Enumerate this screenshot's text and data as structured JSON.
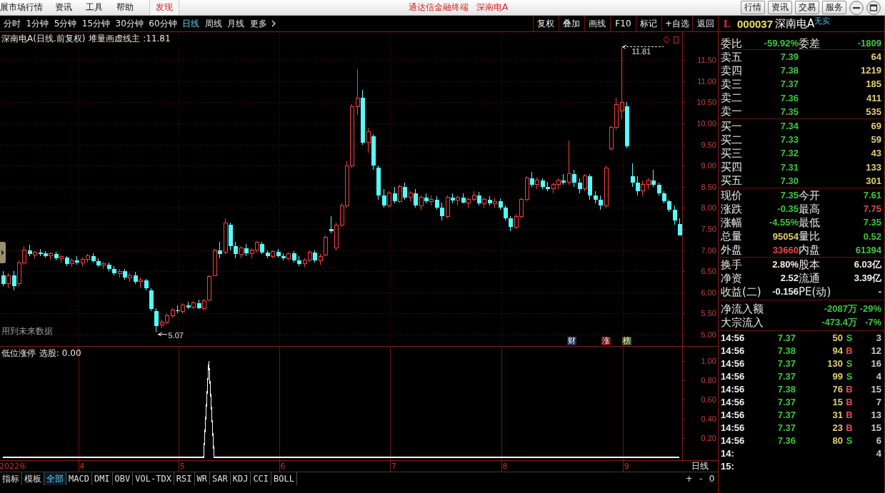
{
  "title_bar": {
    "menus": [
      "展市场行情",
      "资讯",
      "工具",
      "帮助"
    ],
    "discover": "发现",
    "app_name": "通达信金融终端",
    "security": "深南电A",
    "buttons": [
      "行情",
      "资讯",
      "交易",
      "服务"
    ]
  },
  "period_tabs": [
    {
      "label": "分时",
      "selected": false
    },
    {
      "label": "1分钟",
      "selected": false
    },
    {
      "label": "5分钟",
      "selected": false
    },
    {
      "label": "15分钟",
      "selected": false
    },
    {
      "label": "30分钟",
      "selected": false
    },
    {
      "label": "60分钟",
      "selected": false
    },
    {
      "label": "日线",
      "selected": true
    },
    {
      "label": "周线",
      "selected": false
    },
    {
      "label": "月线",
      "selected": false
    }
  ],
  "more": "更多",
  "chart_tools": [
    "复权",
    "叠加",
    "画线",
    "F10",
    "标记",
    "+自选",
    "返回"
  ],
  "quote_header": {
    "market": "L",
    "code": "000037",
    "name": "深南电A",
    "tag": "无实"
  },
  "chart": {
    "title": "深南电A(日线.前复权)",
    "indicator": "堆量画虚线主 :11.81",
    "note": "用到未来数据",
    "events": [
      {
        "label": "财",
        "kind": "finance"
      },
      {
        "label": "涨",
        "kind": "limit"
      },
      {
        "label": "榜",
        "kind": "ranking"
      }
    ],
    "indicator_name": "低位涨停",
    "indicator_value": "选股: 0.00",
    "chart_data": [
      {
        "type": "candlestick",
        "ylim": [
          4.73,
          12.16
        ],
        "yticks": [
          {
            "value": 5,
            "label": "5.00"
          },
          {
            "value": 5.5,
            "label": "5.50"
          },
          {
            "value": 6,
            "label": "6.00"
          },
          {
            "value": 6.5,
            "label": "6.50"
          },
          {
            "value": 7,
            "label": "7.00"
          },
          {
            "value": 7.5,
            "label": "7.50"
          },
          {
            "value": 8,
            "label": "8.00"
          },
          {
            "value": 8.5,
            "label": "8.50"
          },
          {
            "value": 9,
            "label": "9.00"
          },
          {
            "value": 9.5,
            "label": "9.50"
          },
          {
            "value": 10,
            "label": "10.00"
          },
          {
            "value": 10.5,
            "label": "10.50"
          },
          {
            "value": 11,
            "label": "11.00"
          },
          {
            "value": 11.5,
            "label": "11.50"
          }
        ],
        "grid": true,
        "annotations": [
          "11.81",
          "5.07"
        ],
        "ohlc": [
          [
            6.4,
            6.5,
            6.15,
            6.2
          ],
          [
            6.2,
            6.45,
            6.1,
            6.4
          ],
          [
            6.4,
            6.5,
            6.05,
            6.15
          ],
          [
            6.2,
            6.75,
            6.15,
            6.7
          ],
          [
            6.7,
            7.1,
            6.65,
            7.0
          ],
          [
            7.0,
            7.12,
            6.85,
            6.9
          ],
          [
            6.88,
            6.98,
            6.8,
            6.95
          ],
          [
            6.95,
            7.02,
            6.85,
            6.9
          ],
          [
            6.92,
            6.98,
            6.82,
            6.86
          ],
          [
            6.86,
            6.95,
            6.78,
            6.92
          ],
          [
            6.9,
            6.96,
            6.75,
            6.8
          ],
          [
            6.8,
            6.88,
            6.7,
            6.85
          ],
          [
            6.82,
            6.86,
            6.62,
            6.68
          ],
          [
            6.68,
            6.8,
            6.6,
            6.75
          ],
          [
            6.75,
            6.85,
            6.65,
            6.7
          ],
          [
            6.7,
            6.82,
            6.62,
            6.78
          ],
          [
            6.78,
            6.9,
            6.72,
            6.86
          ],
          [
            6.86,
            6.92,
            6.7,
            6.74
          ],
          [
            6.74,
            6.8,
            6.6,
            6.64
          ],
          [
            6.64,
            6.72,
            6.55,
            6.68
          ],
          [
            6.66,
            6.7,
            6.5,
            6.55
          ],
          [
            6.55,
            6.62,
            6.4,
            6.45
          ],
          [
            6.45,
            6.55,
            6.35,
            6.5
          ],
          [
            6.5,
            6.55,
            6.3,
            6.35
          ],
          [
            6.35,
            6.45,
            6.25,
            6.4
          ],
          [
            6.4,
            6.48,
            6.2,
            6.25
          ],
          [
            6.25,
            6.35,
            6.1,
            6.3
          ],
          [
            6.28,
            6.32,
            6.05,
            6.1
          ],
          [
            6.05,
            6.1,
            5.55,
            5.6
          ],
          [
            5.55,
            5.62,
            5.07,
            5.2
          ],
          [
            5.22,
            5.35,
            5.15,
            5.3
          ],
          [
            5.3,
            5.5,
            5.25,
            5.45
          ],
          [
            5.45,
            5.62,
            5.4,
            5.58
          ],
          [
            5.58,
            5.7,
            5.5,
            5.55
          ],
          [
            5.55,
            5.75,
            5.5,
            5.7
          ],
          [
            5.7,
            5.78,
            5.6,
            5.65
          ],
          [
            5.65,
            5.8,
            5.6,
            5.75
          ],
          [
            5.75,
            5.82,
            5.6,
            5.62
          ],
          [
            5.62,
            5.85,
            5.58,
            5.8
          ],
          [
            5.82,
            6.4,
            5.8,
            6.38
          ],
          [
            6.4,
            7.02,
            6.38,
            7.0
          ],
          [
            7.0,
            7.2,
            6.8,
            6.9
          ],
          [
            6.95,
            7.75,
            6.9,
            7.65
          ],
          [
            7.6,
            7.65,
            7.0,
            7.1
          ],
          [
            7.1,
            7.2,
            6.8,
            6.9
          ],
          [
            6.9,
            7.1,
            6.8,
            7.05
          ],
          [
            7.05,
            7.15,
            6.85,
            6.92
          ],
          [
            6.92,
            7.05,
            6.8,
            7.0
          ],
          [
            7.0,
            7.22,
            6.95,
            7.18
          ],
          [
            7.15,
            7.2,
            6.9,
            6.95
          ],
          [
            6.95,
            7.0,
            6.8,
            6.85
          ],
          [
            6.85,
            7.0,
            6.8,
            6.96
          ],
          [
            6.96,
            7.02,
            6.82,
            6.86
          ],
          [
            6.86,
            6.92,
            6.75,
            6.8
          ],
          [
            6.8,
            6.95,
            6.75,
            6.92
          ],
          [
            6.92,
            6.98,
            6.7,
            6.75
          ],
          [
            6.75,
            6.85,
            6.62,
            6.68
          ],
          [
            6.68,
            6.8,
            6.6,
            6.76
          ],
          [
            6.76,
            7.0,
            6.72,
            6.95
          ],
          [
            6.95,
            7.0,
            6.7,
            6.75
          ],
          [
            6.75,
            6.9,
            6.65,
            6.85
          ],
          [
            6.88,
            7.35,
            6.85,
            7.3
          ],
          [
            7.5,
            7.8,
            7.4,
            7.45
          ],
          [
            7.05,
            7.65,
            7.0,
            7.6
          ],
          [
            7.6,
            8.1,
            7.55,
            8.05
          ],
          [
            8.05,
            9.1,
            8.0,
            9.0
          ],
          [
            9.0,
            10.45,
            8.95,
            10.4
          ],
          [
            10.4,
            11.28,
            10.2,
            10.6
          ],
          [
            10.6,
            10.8,
            9.5,
            9.55
          ],
          [
            9.55,
            9.9,
            9.3,
            9.8
          ],
          [
            9.7,
            9.75,
            8.9,
            9.0
          ],
          [
            8.95,
            9.0,
            8.2,
            8.3
          ],
          [
            8.3,
            8.45,
            8.0,
            8.05
          ],
          [
            8.05,
            8.4,
            8.0,
            8.35
          ],
          [
            8.35,
            8.5,
            8.1,
            8.15
          ],
          [
            8.15,
            8.55,
            8.1,
            8.5
          ],
          [
            8.5,
            8.6,
            8.2,
            8.25
          ],
          [
            8.25,
            8.4,
            8.15,
            8.35
          ],
          [
            8.35,
            8.45,
            8.0,
            8.05
          ],
          [
            8.05,
            8.3,
            7.95,
            8.25
          ],
          [
            8.25,
            8.35,
            8.1,
            8.15
          ],
          [
            8.15,
            8.3,
            8.05,
            8.2
          ],
          [
            8.2,
            8.28,
            7.95,
            8.0
          ],
          [
            8.0,
            8.12,
            7.7,
            7.8
          ],
          [
            7.8,
            8.3,
            7.75,
            8.25
          ],
          [
            8.25,
            8.35,
            8.1,
            8.18
          ],
          [
            8.18,
            8.3,
            8.05,
            8.25
          ],
          [
            8.25,
            8.35,
            8.1,
            8.12
          ],
          [
            8.12,
            8.25,
            8.0,
            8.2
          ],
          [
            8.2,
            8.4,
            8.15,
            8.3
          ],
          [
            8.3,
            8.38,
            8.05,
            8.1
          ],
          [
            8.1,
            8.25,
            8.0,
            8.2
          ],
          [
            8.2,
            8.28,
            8.05,
            8.1
          ],
          [
            8.1,
            8.25,
            8.0,
            8.15
          ],
          [
            8.15,
            8.22,
            7.95,
            8.0
          ],
          [
            8.0,
            8.05,
            7.7,
            7.75
          ],
          [
            7.75,
            7.8,
            7.45,
            7.55
          ],
          [
            7.55,
            7.85,
            7.5,
            7.8
          ],
          [
            7.8,
            8.25,
            7.75,
            8.2
          ],
          [
            8.2,
            8.75,
            8.15,
            8.7
          ],
          [
            8.7,
            8.85,
            8.5,
            8.55
          ],
          [
            8.55,
            8.72,
            8.45,
            8.65
          ],
          [
            8.65,
            8.7,
            8.45,
            8.5
          ],
          [
            8.5,
            8.62,
            8.4,
            8.45
          ],
          [
            8.45,
            8.6,
            8.35,
            8.55
          ],
          [
            8.55,
            8.7,
            8.45,
            8.65
          ],
          [
            8.65,
            8.8,
            8.55,
            8.6
          ],
          [
            8.6,
            9.6,
            8.55,
            8.8
          ],
          [
            8.8,
            8.9,
            8.5,
            8.6
          ],
          [
            8.6,
            8.7,
            8.35,
            8.45
          ],
          [
            8.45,
            8.8,
            8.4,
            8.75
          ],
          [
            8.75,
            8.8,
            8.2,
            8.3
          ],
          [
            8.3,
            8.4,
            8.1,
            8.2
          ],
          [
            8.2,
            8.3,
            7.95,
            8.05
          ],
          [
            8.05,
            9.0,
            8.0,
            8.95
          ],
          [
            9.4,
            9.95,
            9.35,
            9.9
          ],
          [
            9.9,
            10.6,
            9.85,
            10.45
          ],
          [
            10.3,
            11.81,
            10.1,
            10.5
          ],
          [
            10.4,
            10.5,
            9.4,
            9.45
          ],
          [
            8.75,
            9.05,
            8.5,
            8.6
          ],
          [
            8.6,
            8.75,
            8.3,
            8.4
          ],
          [
            8.4,
            8.65,
            8.3,
            8.55
          ],
          [
            8.55,
            8.7,
            8.45,
            8.65
          ],
          [
            8.65,
            8.9,
            8.5,
            8.55
          ],
          [
            8.55,
            8.6,
            8.3,
            8.35
          ],
          [
            8.35,
            8.4,
            8.1,
            8.15
          ],
          [
            8.15,
            8.2,
            7.9,
            7.95
          ],
          [
            7.95,
            8.05,
            7.6,
            7.7
          ],
          [
            7.61,
            7.75,
            7.35,
            7.35
          ]
        ]
      },
      {
        "type": "line",
        "color": "#ffffff",
        "grid": true,
        "ylim": [
          -0.03,
          1.15
        ],
        "yticks": [
          {
            "value": 0.2,
            "label": "0.20"
          },
          {
            "value": 0.4,
            "label": "0.40"
          },
          {
            "value": 0.6,
            "label": "0.60"
          },
          {
            "value": 0.8,
            "label": "0.80"
          },
          {
            "value": 1,
            "label": "1.00"
          }
        ],
        "categories": [
          null,
          null,
          "2022年",
          null,
          null,
          null,
          null,
          null,
          null,
          null,
          null,
          null,
          null,
          null,
          null,
          "4",
          null,
          null,
          null,
          null,
          null,
          null,
          null,
          null,
          null,
          null,
          null,
          null,
          null,
          null,
          null,
          null,
          null,
          null,
          "5",
          null,
          null,
          null,
          null,
          null,
          null,
          null,
          null,
          null,
          null,
          null,
          null,
          null,
          null,
          null,
          null,
          null,
          null,
          "6",
          null,
          null,
          null,
          null,
          null,
          null,
          null,
          null,
          null,
          null,
          null,
          null,
          null,
          null,
          null,
          null,
          null,
          null,
          null,
          null,
          "7",
          null,
          null,
          null,
          null,
          null,
          null,
          null,
          null,
          null,
          null,
          null,
          null,
          null,
          null,
          null,
          null,
          null,
          null,
          null,
          null,
          "8",
          null,
          null,
          null,
          null,
          null,
          null,
          null,
          null,
          null,
          null,
          null,
          null,
          null,
          null,
          null,
          null,
          null,
          null,
          null,
          null,
          null,
          null,
          "9",
          null,
          null,
          null,
          null,
          null,
          null,
          null,
          null,
          null,
          null
        ],
        "values": [
          0,
          0,
          0,
          0,
          0,
          0,
          0,
          0,
          0,
          0,
          0,
          0,
          0,
          0,
          0,
          0,
          0,
          0,
          0,
          0,
          0,
          0,
          0,
          0,
          0,
          0,
          0,
          0,
          0,
          0,
          0,
          0,
          0,
          0,
          0,
          0,
          0,
          0,
          0,
          1,
          0,
          0,
          0,
          0,
          0,
          0,
          0,
          0,
          0,
          0,
          0,
          0,
          0,
          0,
          0,
          0,
          0,
          0,
          0,
          0,
          0,
          0,
          0,
          0,
          0,
          0,
          0,
          0,
          0,
          0,
          0,
          0,
          0,
          0,
          0,
          0,
          0,
          0,
          0,
          0,
          0,
          0,
          0,
          0,
          0,
          0,
          0,
          0,
          0,
          0,
          0,
          0,
          0,
          0,
          0,
          0,
          0,
          0,
          0,
          0,
          0,
          0,
          0,
          0,
          0,
          0,
          0,
          0,
          0,
          0,
          0,
          0,
          0,
          0,
          0,
          0,
          0,
          0,
          0,
          0,
          0,
          0,
          0,
          0,
          0,
          0,
          0,
          0,
          0
        ]
      }
    ]
  },
  "axis_period": "日线",
  "indicator_tabs": [
    {
      "label": "指标",
      "selected": false
    },
    {
      "label": "模板",
      "selected": false
    },
    {
      "label": "全部",
      "selected": true
    },
    {
      "label": "MACD",
      "selected": false
    },
    {
      "label": "DMI",
      "selected": false
    },
    {
      "label": "OBV",
      "selected": false
    },
    {
      "label": "VOL-TDX",
      "selected": false
    },
    {
      "label": "RSI",
      "selected": false
    },
    {
      "label": "WR",
      "selected": false
    },
    {
      "label": "SAR",
      "selected": false
    },
    {
      "label": "KDJ",
      "selected": false
    },
    {
      "label": "CCI",
      "selected": false
    },
    {
      "label": "BOLL",
      "selected": false
    }
  ],
  "zoom_buttons": [
    "+",
    "-",
    "0"
  ],
  "order_book": {
    "summary": [
      {
        "label": "委比",
        "value": "-59.92%",
        "color": "#3cc83c"
      },
      {
        "label": "委差",
        "value": "-1809",
        "color": "#3cc83c"
      }
    ],
    "asks": [
      {
        "label": "卖五",
        "price": "7.39",
        "volume": "64",
        "color": "#3cc83c"
      },
      {
        "label": "卖四",
        "price": "7.38",
        "volume": "1219",
        "color": "#3cc83c"
      },
      {
        "label": "卖三",
        "price": "7.37",
        "volume": "185",
        "color": "#3cc83c"
      },
      {
        "label": "卖二",
        "price": "7.36",
        "volume": "411",
        "color": "#3cc83c"
      },
      {
        "label": "卖一",
        "price": "7.35",
        "volume": "535",
        "color": "#3cc83c"
      }
    ],
    "bids": [
      {
        "label": "买一",
        "price": "7.34",
        "volume": "69",
        "color": "#3cc83c"
      },
      {
        "label": "买二",
        "price": "7.33",
        "volume": "59",
        "color": "#3cc83c"
      },
      {
        "label": "买三",
        "price": "7.32",
        "volume": "43",
        "color": "#3cc83c"
      },
      {
        "label": "买四",
        "price": "7.31",
        "volume": "133",
        "color": "#3cc83c"
      },
      {
        "label": "买五",
        "price": "7.30",
        "volume": "301",
        "color": "#3cc83c"
      }
    ]
  },
  "stats": [
    {
      "label": "现价",
      "value": "7.35",
      "color": "#3cc83c"
    },
    {
      "label": "今开",
      "value": "7.61",
      "color": "#3cc83c"
    },
    {
      "label": "涨跌",
      "value": "-0.35",
      "color": "#3cc83c"
    },
    {
      "label": "最高",
      "value": "7.75",
      "color": "#e84848"
    },
    {
      "label": "涨幅",
      "value": "-4.55%",
      "color": "#3cc83c"
    },
    {
      "label": "最低",
      "value": "7.35",
      "color": "#3cc83c"
    },
    {
      "label": "总量",
      "value": "95054",
      "color": "#e0d070"
    },
    {
      "label": "量比",
      "value": "0.52",
      "color": "#3cc83c"
    },
    {
      "label": "外盘",
      "value": "33660",
      "color": "#e84848"
    },
    {
      "label": "内盘",
      "value": "61394",
      "color": "#3cc83c"
    }
  ],
  "fundamentals": [
    {
      "label": "换手",
      "value": "2.80%"
    },
    {
      "label": "股本",
      "value": "6.03亿"
    },
    {
      "label": "净资",
      "value": "2.52"
    },
    {
      "label": "流通",
      "value": "3.39亿"
    },
    {
      "label": "收益(二)",
      "value": "-0.156"
    },
    {
      "label": "PE(动)",
      "value": "-"
    }
  ],
  "fund_flow": [
    {
      "label": "净流入额",
      "amount": "-2087万",
      "ratio": "-29%",
      "color": "#3cc83c"
    },
    {
      "label": "大宗流入",
      "amount": "-473.4万",
      "ratio": "-7%",
      "color": "#3cc83c"
    }
  ],
  "ticks": [
    {
      "time": "14:56",
      "price": "7.37",
      "volume": "50",
      "side": "S",
      "count": "3",
      "kind": "sell",
      "color": "#3cc83c"
    },
    {
      "time": "14:56",
      "price": "7.38",
      "volume": "94",
      "side": "B",
      "count": "12",
      "kind": "buy",
      "color": "#3cc83c"
    },
    {
      "time": "14:56",
      "price": "7.37",
      "volume": "130",
      "side": "S",
      "count": "16",
      "kind": "sell",
      "color": "#3cc83c"
    },
    {
      "time": "14:56",
      "price": "7.37",
      "volume": "99",
      "side": "S",
      "count": "4",
      "kind": "sell",
      "color": "#3cc83c"
    },
    {
      "time": "14:56",
      "price": "7.38",
      "volume": "76",
      "side": "B",
      "count": "15",
      "kind": "buy",
      "color": "#3cc83c"
    },
    {
      "time": "14:56",
      "price": "7.37",
      "volume": "15",
      "side": "B",
      "count": "7",
      "kind": "buy",
      "color": "#3cc83c"
    },
    {
      "time": "14:56",
      "price": "7.37",
      "volume": "31",
      "side": "B",
      "count": "13",
      "kind": "buy",
      "color": "#3cc83c"
    },
    {
      "time": "14:56",
      "price": "7.37",
      "volume": "23",
      "side": "B",
      "count": "15",
      "kind": "buy",
      "color": "#3cc83c"
    },
    {
      "time": "14:56",
      "price": "7.36",
      "volume": "80",
      "side": "S",
      "count": "6",
      "kind": "sell",
      "color": "#3cc83c"
    },
    {
      "time": "14:",
      "count": "4"
    },
    {
      "time": "15:"
    }
  ]
}
